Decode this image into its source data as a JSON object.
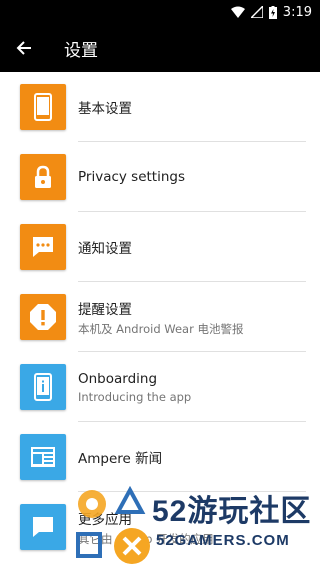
{
  "status_bar": {
    "time": "3:19"
  },
  "app_bar": {
    "title": "设置"
  },
  "items": [
    {
      "label": "基本设置",
      "subtitle": "",
      "icon": "phone-icon",
      "color": "#F28C13"
    },
    {
      "label": "Privacy settings",
      "subtitle": "",
      "icon": "lock-icon",
      "color": "#F28C13"
    },
    {
      "label": "通知设置",
      "subtitle": "",
      "icon": "chat-bubble-icon",
      "color": "#F28C13"
    },
    {
      "label": "提醒设置",
      "subtitle": "本机及 Android Wear 电池警报",
      "icon": "alert-icon",
      "color": "#F28C13"
    },
    {
      "label": "Onboarding",
      "subtitle": "Introducing the app",
      "icon": "info-phone-icon",
      "color": "#3AA8E6"
    },
    {
      "label": "Ampere 新闻",
      "subtitle": "",
      "icon": "news-icon",
      "color": "#3AA8E6"
    },
    {
      "label": "更多应用",
      "subtitle": "其它由 ... app 开发的应用",
      "icon": "chat-icon",
      "color": "#3AA8E6"
    }
  ],
  "watermark": {
    "big": "52游玩社区",
    "small": "52GAMERS.COM"
  }
}
